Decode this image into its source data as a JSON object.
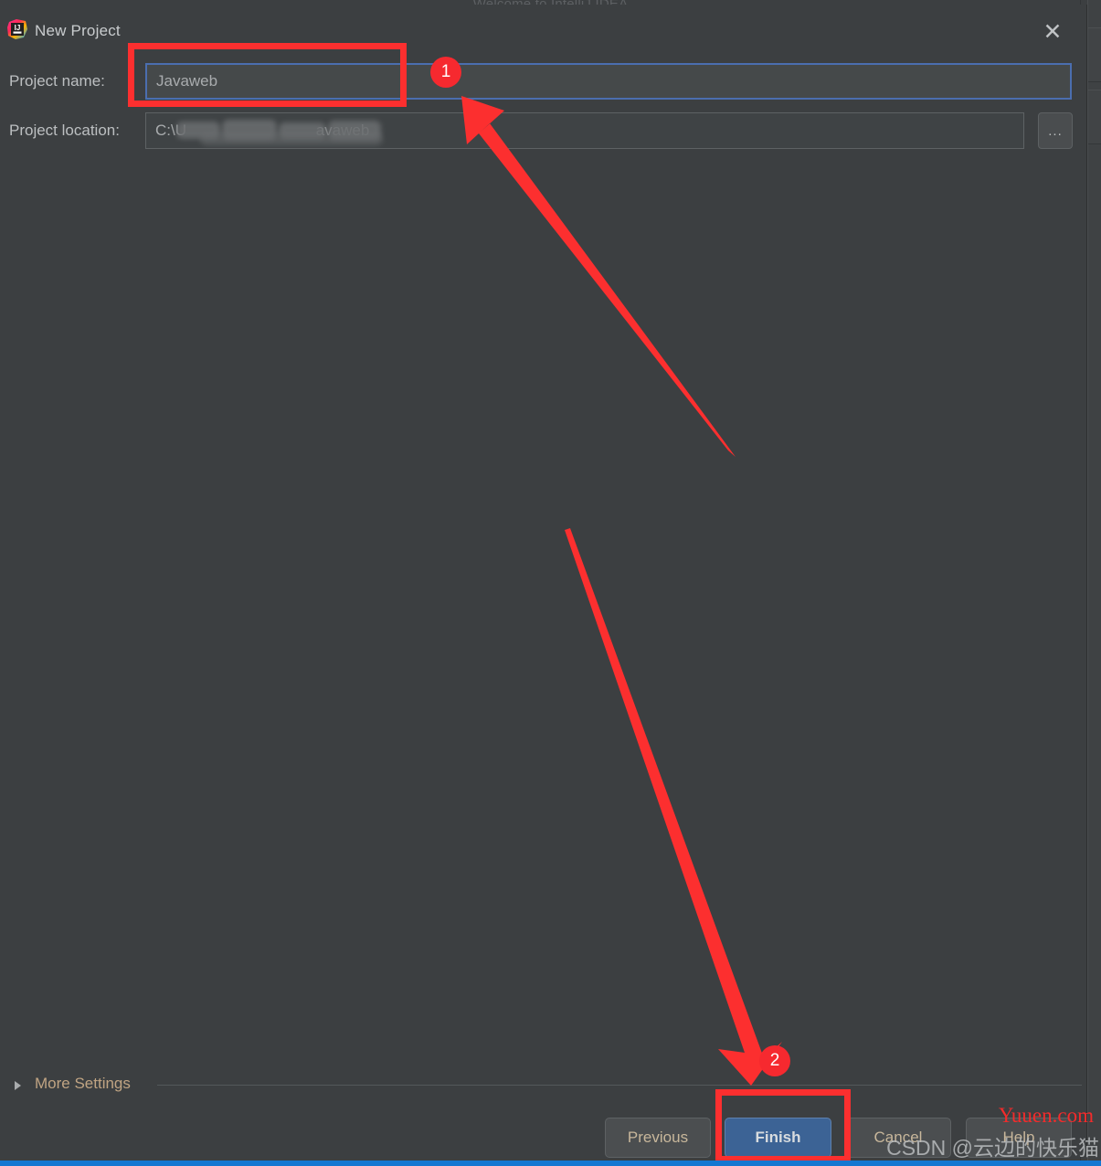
{
  "background": {
    "window_title": "Welcome to IntelliJ IDEA"
  },
  "dialog": {
    "title": "New Project",
    "icon": "intellij-idea-icon",
    "close_label": "✕"
  },
  "form": {
    "project_name": {
      "label": "Project name:",
      "value": "Javaweb",
      "placeholder": "Project name"
    },
    "project_location": {
      "label": "Project location:",
      "value": "C:\\U                              avaweb",
      "placeholder": "Project location",
      "browse_label": "..."
    }
  },
  "more_settings": {
    "label": "More Settings",
    "expanded": false,
    "arrow_icon": "chevron-right-icon"
  },
  "buttons": {
    "previous": "Previous",
    "finish": "Finish",
    "cancel": "Cancel",
    "help": "Help"
  },
  "annotations": {
    "badge_1": "1",
    "badge_2": "2",
    "accent_color": "#fc2f2f"
  },
  "watermarks": {
    "red": "Yuuen.com",
    "gray": "CSDN @云边的快乐猫"
  },
  "colors": {
    "dialog_background": "#3c3f41",
    "input_background": "#45494a",
    "focus_border": "#4b6eaf",
    "primary_button": "#3c6395",
    "link_text": "#c0a483",
    "annotation_red": "#fc2f2f",
    "taskbar_blue": "#1477d1"
  }
}
